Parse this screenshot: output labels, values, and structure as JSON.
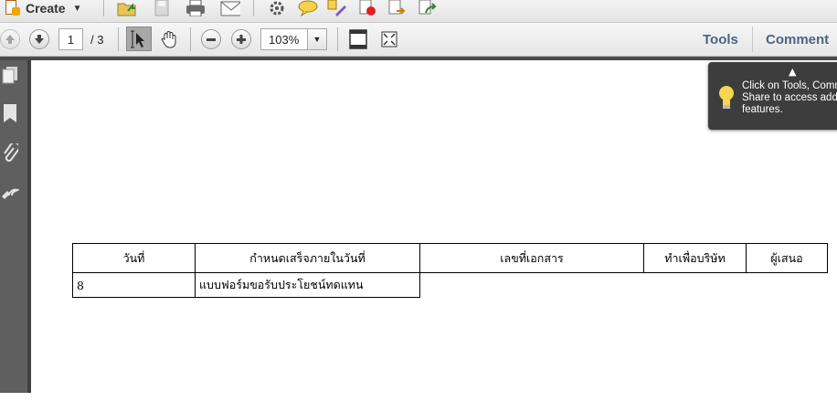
{
  "toolbar1": {
    "create_label": "Create",
    "icons": [
      "open-folder-icon",
      "save-icon",
      "print-icon",
      "email-icon",
      "settings-gear-icon",
      "comment-icon",
      "highlight-icon",
      "stamp-icon",
      "export-icon",
      "share-icon"
    ]
  },
  "toolbar2": {
    "page_current": "1",
    "page_total": "/ 3",
    "zoom": "103%",
    "tools_label": "Tools",
    "comment_label": "Comment"
  },
  "tooltip": {
    "text": "Click on Tools, Comme\nShare to access additi\nfeatures."
  },
  "table": {
    "headers": [
      "วันที่",
      "กำหนดเสร็จภายในวันที่",
      "เลขที่เอกสาร",
      "ทำเพื่อบริษัท",
      "ผู้เสนอ"
    ],
    "row": [
      "8",
      "แบบฟอร์มขอรับประโยชน์ทดแทน"
    ]
  },
  "colors": {
    "tab_text": "#4a6683",
    "left_panel": "#5f5f5f",
    "tooltip_bg": "#3d3d3d"
  }
}
